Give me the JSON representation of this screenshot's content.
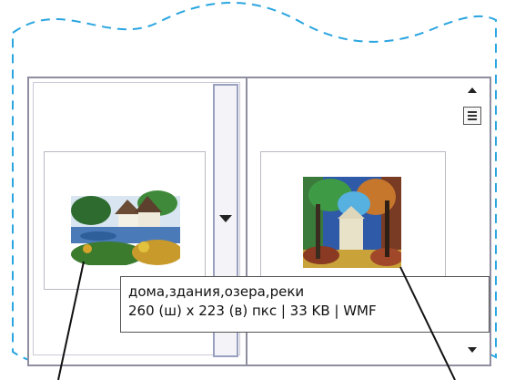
{
  "gallery": {
    "items": [
      {
        "name": "lake-houses-thumbnail",
        "description_colors": [
          "#2d6b2f",
          "#f3f0e6",
          "#4a7ab8"
        ]
      },
      {
        "name": "forest-painting-thumbnail",
        "description_colors": [
          "#2e5aa8",
          "#e8e2c8",
          "#3a7b3c"
        ]
      }
    ],
    "tooltip": {
      "line1": "дома,здания,озера,реки",
      "line2": "260 (ш) x 223 (в) пкс | 33 KB | WMF"
    },
    "icons": {
      "dropdown": "chevron-down-icon",
      "scroll_up": "scroll-up-arrow-icon",
      "scroll_down": "scroll-down-arrow-icon",
      "menu": "menu-list-icon"
    },
    "colors": {
      "dashed_outline": "#2aa5e0",
      "panel_border": "#8e8ea0",
      "pointer_line": "#111111"
    }
  }
}
